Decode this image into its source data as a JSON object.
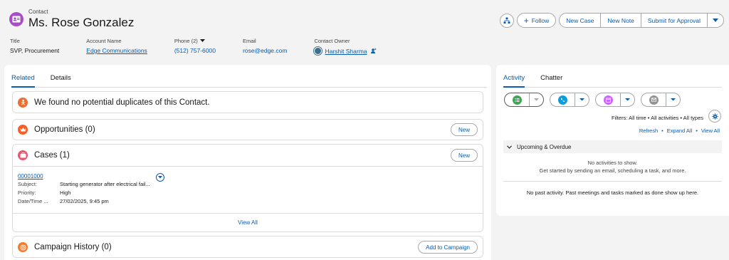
{
  "header": {
    "object_type": "Contact",
    "title": "Ms. Rose Gonzalez",
    "actions": {
      "follow": "Follow",
      "new_case": "New Case",
      "new_note": "New Note",
      "submit": "Submit for Approval"
    },
    "fields": {
      "title_label": "Title",
      "title_value": "SVP, Procurement",
      "account_label": "Account Name",
      "account_value": "Edge Communications",
      "phone_label": "Phone (2)",
      "phone_value": "(512) 757-6000",
      "email_label": "Email",
      "email_value": "rose@edge.com",
      "owner_label": "Contact Owner",
      "owner_value": "Harshit Sharma"
    }
  },
  "left": {
    "tabs": [
      "Related",
      "Details"
    ],
    "duplicates_text": "We found no potential duplicates of this Contact.",
    "opportunities": {
      "title": "Opportunities (0)",
      "button": "New"
    },
    "cases": {
      "title": "Cases (1)",
      "button": "New",
      "case_number": "00001000",
      "rows": [
        {
          "key": "Subject:",
          "value": "Starting generator after electrical fail..."
        },
        {
          "key": "Priority:",
          "value": "High"
        },
        {
          "key": "Date/Time ...",
          "value": "27/02/2025, 9:45 pm"
        }
      ],
      "view_all": "View All"
    },
    "campaign": {
      "title": "Campaign History (0)",
      "button": "Add to Campaign"
    }
  },
  "right": {
    "tabs": [
      "Activity",
      "Chatter"
    ],
    "filters_text": "Filters: All time • All activities • All types",
    "links": {
      "refresh": "Refresh",
      "expand_all": "Expand All",
      "view_all": "View All"
    },
    "upcoming": "Upcoming & Overdue",
    "no_activities_1": "No activities to show.",
    "no_activities_2": "Get started by sending an email, scheduling a task, and more.",
    "past_text": "No past activity. Past meetings and tasks marked as done show up here."
  },
  "colors": {
    "brand": "#0b5cab",
    "contact_icon": "#a94cc8",
    "duplicates_icon": "#ef6e2f",
    "opportunity_icon": "#fc5c25",
    "case_icon": "#f2536d",
    "campaign_icon": "#f97924",
    "task_icon": "#3ba755",
    "call_icon": "#0d9dda",
    "event_icon": "#cb65ff",
    "email_icon": "#939393"
  }
}
